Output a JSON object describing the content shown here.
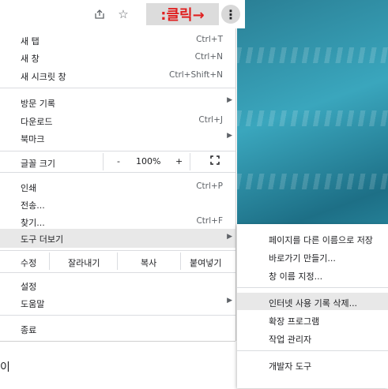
{
  "toolbar": {
    "share_icon": "share-icon",
    "bookmark_icon": "star-icon",
    "menu_icon": "⋮",
    "annotation": ":클릭→"
  },
  "menu": {
    "new_tab": {
      "label": "새 탭",
      "shortcut": "Ctrl+T"
    },
    "new_window": {
      "label": "새 창",
      "shortcut": "Ctrl+N"
    },
    "new_incognito": {
      "label": "새 시크릿 창",
      "shortcut": "Ctrl+Shift+N"
    },
    "history": {
      "label": "방문 기록"
    },
    "downloads": {
      "label": "다운로드",
      "shortcut": "Ctrl+J"
    },
    "bookmarks": {
      "label": "북마크"
    },
    "zoom": {
      "label": "글꼴 크기",
      "minus": "-",
      "value": "100%",
      "plus": "+"
    },
    "print": {
      "label": "인쇄",
      "shortcut": "Ctrl+P"
    },
    "cast": {
      "label": "전송..."
    },
    "find": {
      "label": "찾기...",
      "shortcut": "Ctrl+F"
    },
    "more_tools": {
      "label": "도구 더보기"
    },
    "edit": {
      "label": "수정",
      "cut": "잘라내기",
      "copy": "복사",
      "paste": "붙여넣기"
    },
    "settings": {
      "label": "설정"
    },
    "help": {
      "label": "도움말"
    },
    "exit": {
      "label": "종료"
    }
  },
  "submenu": {
    "save_page": "페이지를 다른 이름으로 저장",
    "create_shortcut": "바로가기 만들기...",
    "name_window": "창 이름 지정...",
    "clear_browsing": "인터넷 사용 기록 삭제...",
    "extensions": "확장 프로그램",
    "task_manager": "작업 관리자",
    "dev_tools": "개발자 도구"
  },
  "page": {
    "bottom_text": "이"
  }
}
